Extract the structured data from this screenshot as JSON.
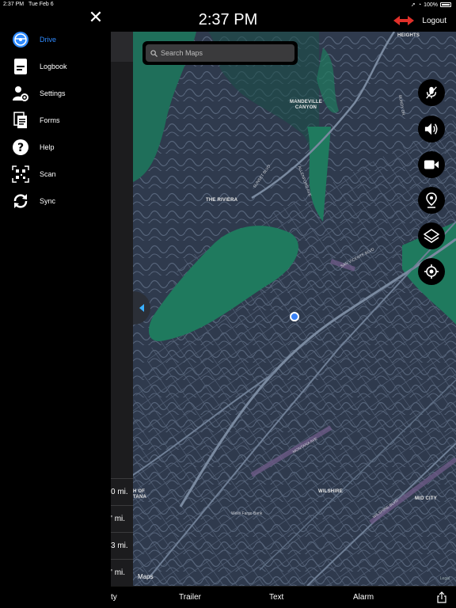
{
  "status_bar": {
    "time": "2:37 PM",
    "date": "Tue Feb 6",
    "battery": "100%"
  },
  "header": {
    "clock": "2:37 PM",
    "logout_label": "Logout"
  },
  "sidebar": {
    "items": [
      {
        "label": "Drive",
        "icon": "steering-wheel-icon",
        "active": true
      },
      {
        "label": "Logbook",
        "icon": "logbook-icon",
        "active": false
      },
      {
        "label": "Settings",
        "icon": "settings-icon",
        "active": false
      },
      {
        "label": "Forms",
        "icon": "forms-icon",
        "active": false
      },
      {
        "label": "Help",
        "icon": "help-icon",
        "active": false
      },
      {
        "label": "Scan",
        "icon": "qr-scan-icon",
        "active": false
      },
      {
        "label": "Sync",
        "icon": "sync-icon",
        "active": false
      }
    ]
  },
  "panel": {
    "distances": [
      "0 mi.",
      "' mi.",
      "3 mi.",
      "' mi."
    ]
  },
  "map": {
    "search_placeholder": "Search Maps",
    "attribution": "Maps",
    "legal": "Legal",
    "labels": {
      "heights": "HEIGHTS",
      "mandeville": "MANDEVILLE\nCANYON",
      "riviera": "THE RIVIERA",
      "wilshire": "WILSHIRE",
      "midcity": "MID CITY",
      "montana": "H OF\nTANA",
      "wells_fargo": "Wells Fargo Bank"
    },
    "streets": {
      "sunset": "SUNSET BLVD",
      "san_vicente": "SAN VICENTE BLVD",
      "montana_ave": "MONTANA AVE",
      "wilshire_blvd": "WILSHIRE BLVD",
      "allenford": "ALLENFORD AVE",
      "bundy": "BUNDY DR"
    },
    "buttons": [
      "mute-icon",
      "volume-icon",
      "camera-icon",
      "pin-icon",
      "layers-icon",
      "recenter-icon"
    ]
  },
  "bottom_bar": {
    "tab_partial": "ty",
    "trailer": "Trailer",
    "text": "Text",
    "alarm": "Alarm"
  },
  "colors": {
    "accent": "#2f8bff",
    "logout": "#e0302a",
    "map_bg": "#2f3a4d",
    "park": "#1f7a5e"
  }
}
